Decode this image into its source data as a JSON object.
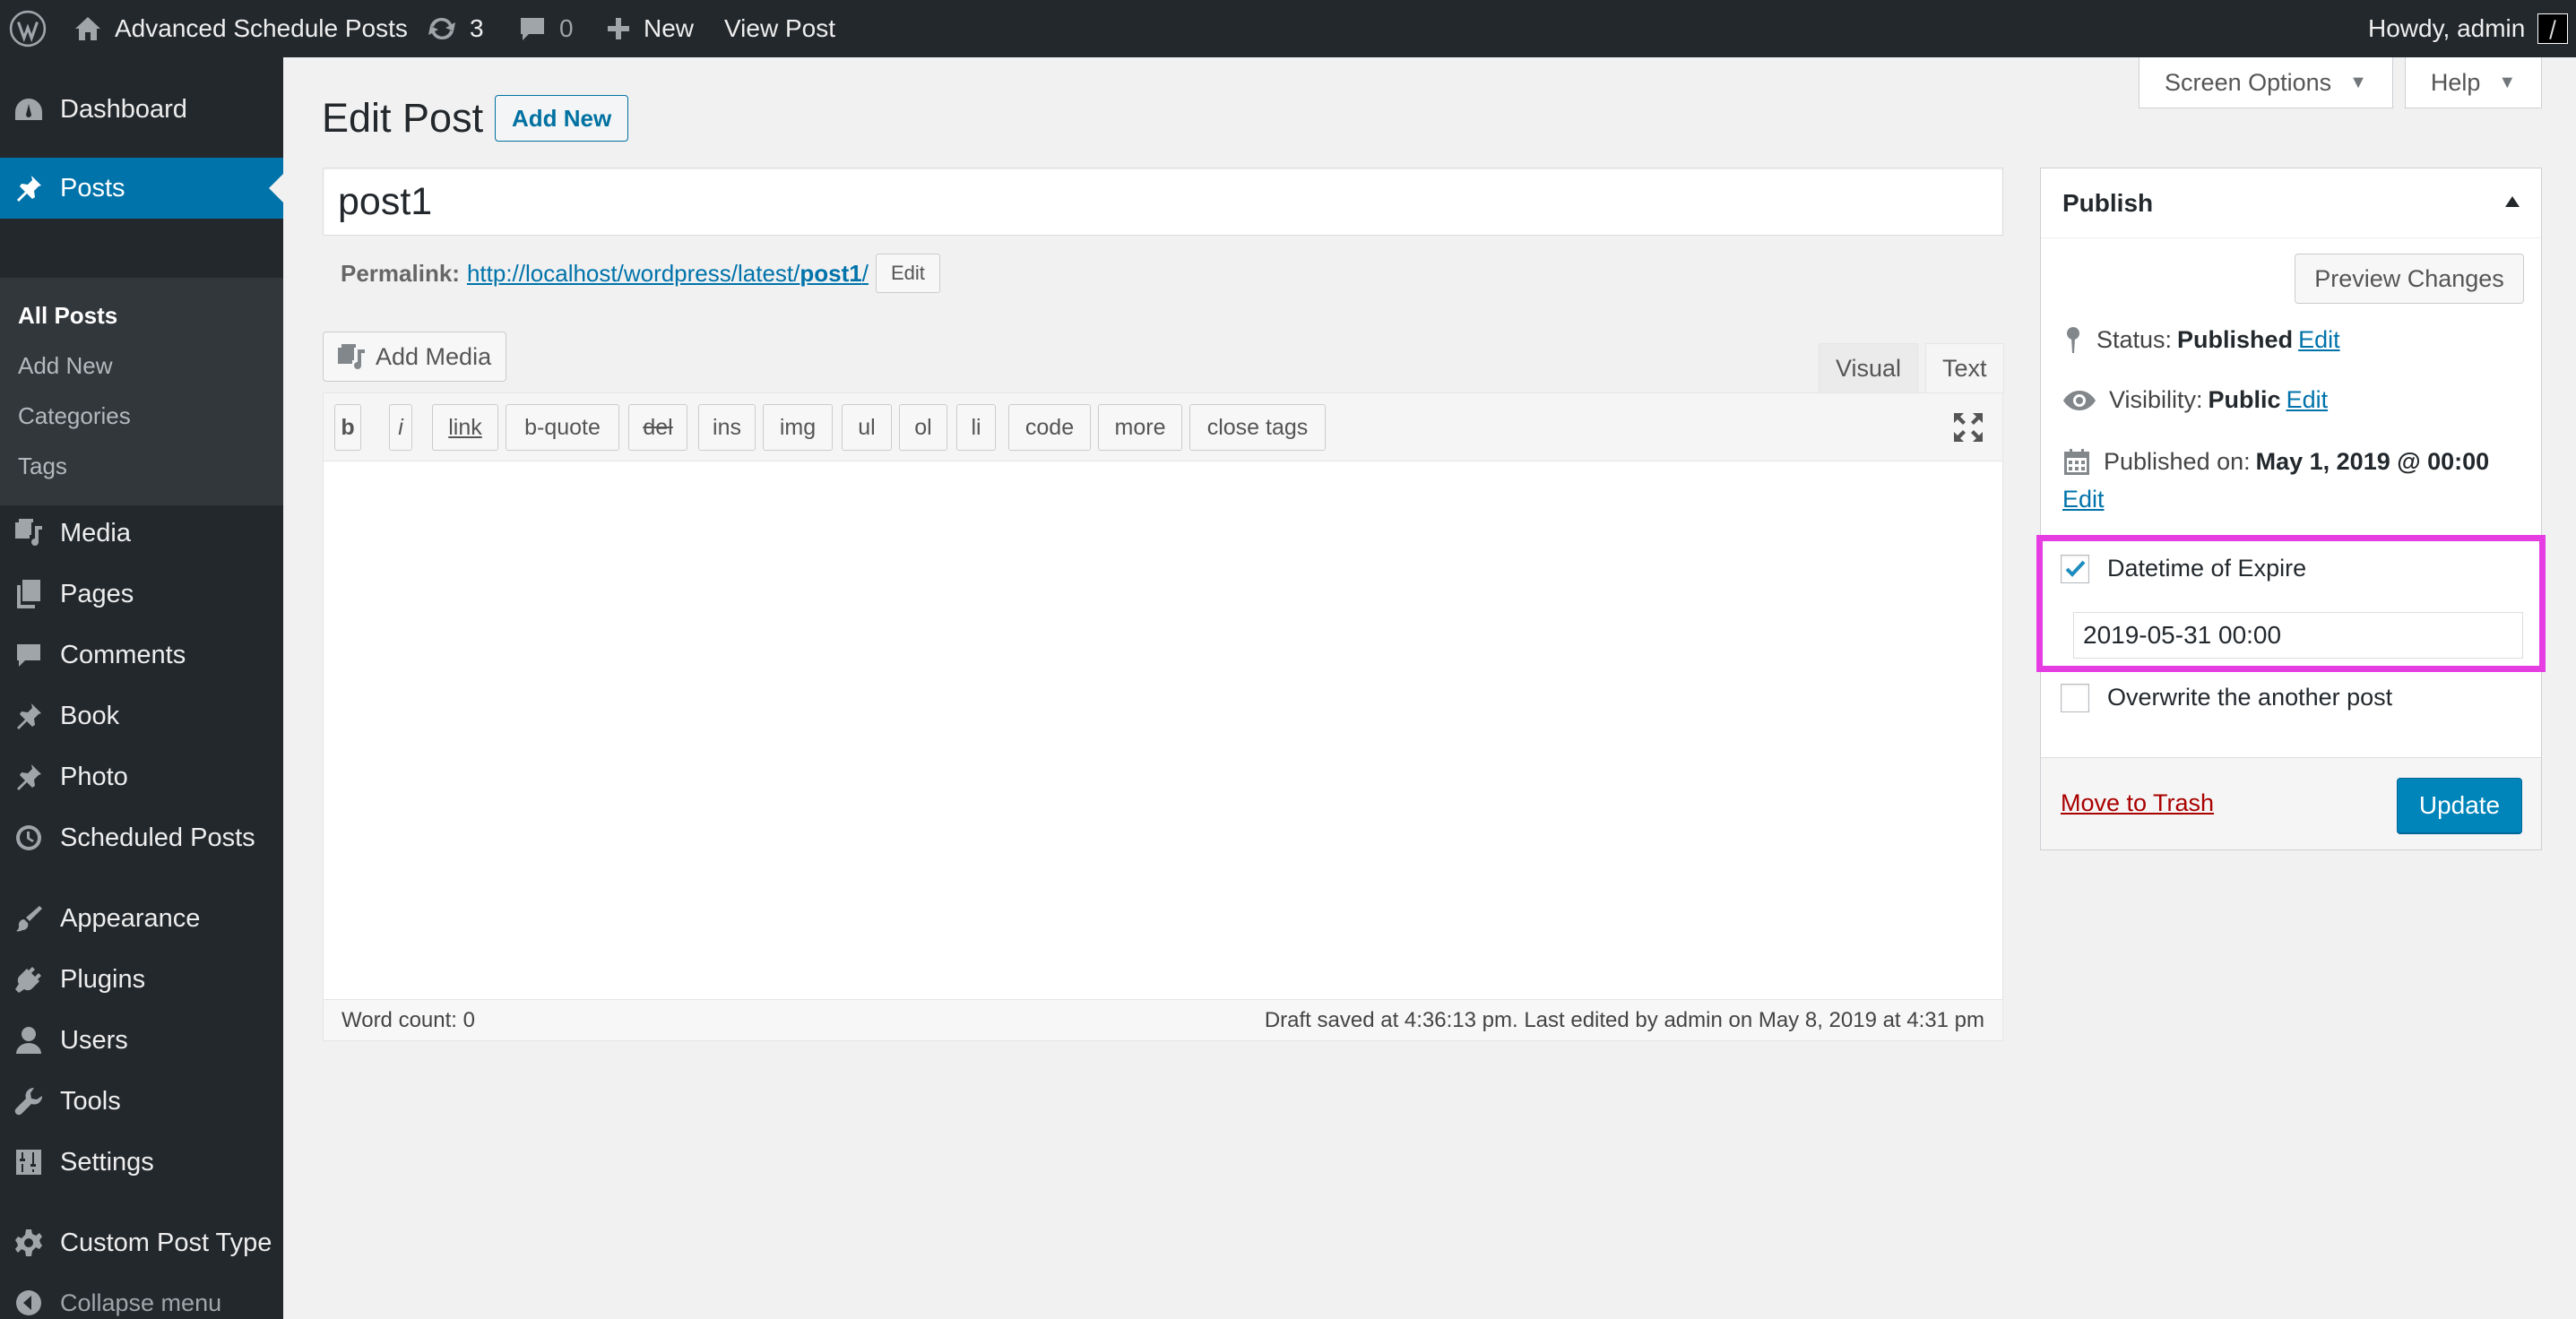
{
  "admin_bar": {
    "site_name": "Advanced Schedule Posts",
    "updates_count": "3",
    "comments_count": "0",
    "new_label": "New",
    "view_post_label": "View Post",
    "howdy_text": "Howdy, admin"
  },
  "sidebar": {
    "items": [
      {
        "label": "Dashboard",
        "icon": "dashboard-icon"
      },
      {
        "label": "Posts",
        "icon": "pin-icon",
        "active": true
      },
      {
        "label": "Media",
        "icon": "media-icon"
      },
      {
        "label": "Pages",
        "icon": "pages-icon"
      },
      {
        "label": "Comments",
        "icon": "comment-icon"
      },
      {
        "label": "Book",
        "icon": "pin-icon"
      },
      {
        "label": "Photo",
        "icon": "pin-icon"
      },
      {
        "label": "Scheduled Posts",
        "icon": "clock-icon"
      },
      {
        "label": "Appearance",
        "icon": "brush-icon"
      },
      {
        "label": "Plugins",
        "icon": "plugin-icon"
      },
      {
        "label": "Users",
        "icon": "user-icon"
      },
      {
        "label": "Tools",
        "icon": "wrench-icon"
      },
      {
        "label": "Settings",
        "icon": "settings-icon"
      },
      {
        "label": "Custom Post Type",
        "icon": "gear-icon"
      }
    ],
    "submenu": [
      "All Posts",
      "Add New",
      "Categories",
      "Tags"
    ],
    "collapse_label": "Collapse menu"
  },
  "header": {
    "screen_options_label": "Screen Options",
    "help_label": "Help",
    "page_title": "Edit Post",
    "add_new_label": "Add New"
  },
  "post": {
    "title": "post1",
    "permalink_label": "Permalink:",
    "permalink_base": "http://localhost/wordpress/latest/",
    "permalink_slug": "post1",
    "permalink_end": "/",
    "permalink_edit_label": "Edit"
  },
  "editor": {
    "add_media_label": "Add Media",
    "tab_visual": "Visual",
    "tab_text": "Text",
    "quicktags": [
      "b",
      "i",
      "link",
      "b-quote",
      "del",
      "ins",
      "img",
      "ul",
      "ol",
      "li",
      "code",
      "more",
      "close tags"
    ],
    "word_count": "Word count: 0",
    "draft_status": "Draft saved at 4:36:13 pm. Last edited by admin on May 8, 2019 at 4:31 pm"
  },
  "publish": {
    "title": "Publish",
    "preview_label": "Preview Changes",
    "status_label": "Status:",
    "status_value": "Published",
    "visibility_label": "Visibility:",
    "visibility_value": "Public",
    "published_label": "Published on:",
    "published_value": "May 1, 2019 @ 00:00",
    "edit_label": "Edit",
    "expire_label": "Datetime of Expire",
    "expire_checked": true,
    "expire_value": "2019-05-31 00:00",
    "overwrite_label": "Overwrite the another post",
    "overwrite_checked": false,
    "trash_label": "Move to Trash",
    "update_label": "Update"
  },
  "colors": {
    "admin_bar_bg": "#23282d",
    "accent": "#0073aa",
    "primary_button": "#0085ba",
    "highlight": "#e63de3",
    "trash": "#a00"
  }
}
